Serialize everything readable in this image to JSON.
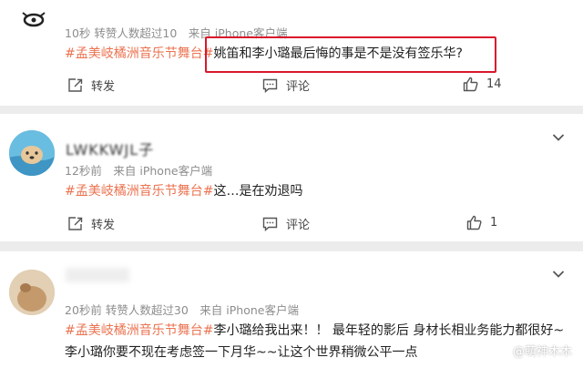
{
  "comments": [
    {
      "meta": "10秒 转赞人数超过10　来自 iPhone客户端",
      "topic": "#孟美岐橘洲音乐节舞台#",
      "text": "姚笛和李小璐最后悔的事是不是没有签乐华?",
      "repost_label": "转发",
      "comment_label": "评论",
      "like_count": "14"
    },
    {
      "username": "LWKKWJL子",
      "meta": "12秒前　来自 iPhone客户端",
      "topic": "#孟美岐橘洲音乐节舞台#",
      "text": "这…是在劝退吗",
      "repost_label": "转发",
      "comment_label": "评论",
      "like_count": "1"
    },
    {
      "meta": "20秒前 转赞人数超过30　来自 iPhone客户端",
      "topic": "#孟美岐橘洲音乐节舞台#",
      "text": "李小璐给我出来！！ 最年轻的影后 身材长相业务能力都很好~",
      "text2": "李小璐你要不现在考虑签一下月华~~让这个世界稍微公平一点"
    }
  ],
  "watermark": "@萌神木木",
  "colors": {
    "topic": "#eb7350",
    "highlight": "#d9182c",
    "background": "#ececec"
  }
}
